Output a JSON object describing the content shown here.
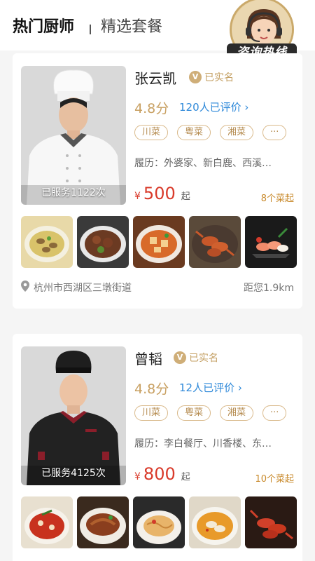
{
  "header": {
    "tab_active": "热门厨师",
    "tab_inactive": "精选套餐",
    "hotline_label": "咨询热线"
  },
  "chefs": [
    {
      "name": "张云凯",
      "verified": "已实名",
      "rating": "4.8分",
      "reviews": "120人已评价 ›",
      "tags": [
        "川菜",
        "粤菜",
        "湘菜",
        "···"
      ],
      "history": "履历：外婆家、新白鹿、西溪…",
      "served": "已服务1122次",
      "price_symbol": "¥",
      "price": "500",
      "price_suffix": "起",
      "min_dishes": "8个菜起",
      "location": "杭州市西湖区三墩街道",
      "distance": "距您1.9km",
      "dish_icons": [
        "clam-soup",
        "braised-meat",
        "tofu-chili",
        "crayfish",
        "sashimi"
      ]
    },
    {
      "name": "曾韬",
      "verified": "已实名",
      "rating": "4.8分",
      "reviews": "12人已评价 ›",
      "tags": [
        "川菜",
        "粤菜",
        "湘菜",
        "···"
      ],
      "history": "履历：李白餐厅、川香楼、东…",
      "served": "已服务4125次",
      "price_symbol": "¥",
      "price": "800",
      "price_suffix": "起",
      "min_dishes": "10个菜起",
      "dish_icons": [
        "boiled-fish",
        "braised-duck",
        "noodles",
        "spicy-fish",
        "crayfish"
      ]
    }
  ],
  "colors": {
    "accent_gold": "#c8a062",
    "price_red": "#d93a2a",
    "link_blue": "#2f89d9"
  }
}
